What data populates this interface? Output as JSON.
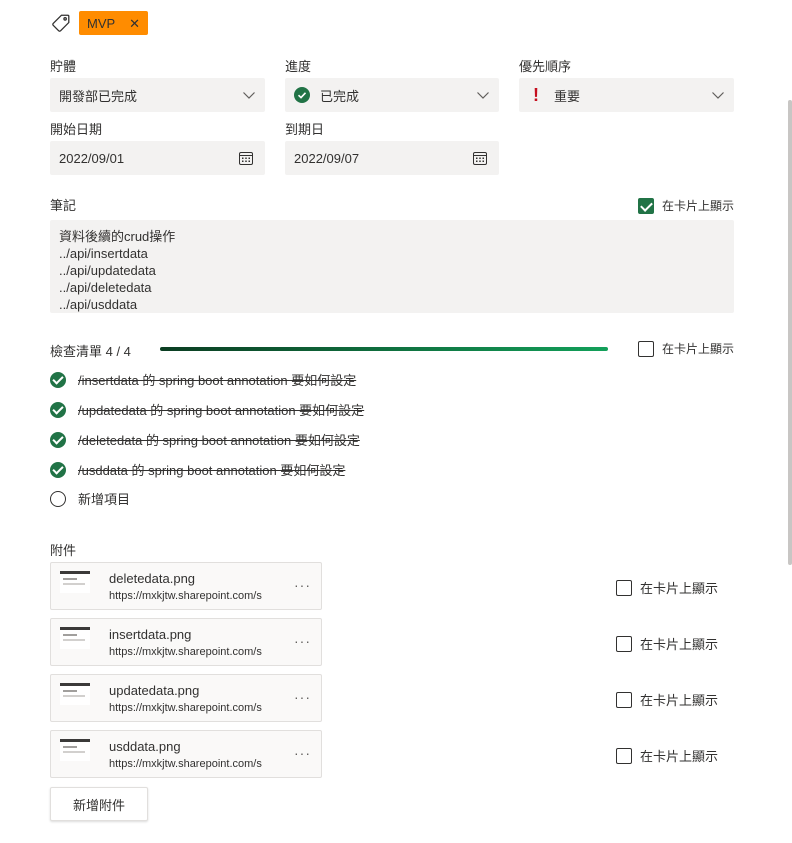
{
  "tag": {
    "label": "MVP",
    "color": "#ff8c00",
    "icon": "tag-icon",
    "close_icon": "close-icon",
    "close_glyph": "✕"
  },
  "bucket": {
    "label": "貯體",
    "value": "開發部已完成"
  },
  "progress": {
    "label": "進度",
    "value": "已完成",
    "icon": "completed-check-icon",
    "color": "#217346"
  },
  "priority": {
    "label": "優先順序",
    "value": "重要",
    "icon": "exclamation-icon",
    "glyph": "!",
    "color": "#c50f1f"
  },
  "start_date": {
    "label": "開始日期",
    "value": "2022/09/01",
    "icon": "calendar-icon"
  },
  "due_date": {
    "label": "到期日",
    "value": "2022/09/07",
    "icon": "calendar-icon"
  },
  "notes": {
    "label": "筆記",
    "show_on_card_label": "在卡片上顯示",
    "show_on_card_checked": true,
    "content": "資料後續的crud操作\n../api/insertdata\n../api/updatedata\n../api/deletedata\n../api/usddata"
  },
  "checklist": {
    "label": "檢查清單 4 / 4",
    "completed": 4,
    "total": 4,
    "show_on_card_label": "在卡片上顯示",
    "show_on_card_checked": false,
    "items": [
      {
        "text": "/insertdata 的 spring boot annotation 要如何設定",
        "done": true
      },
      {
        "text": "/updatedata 的 spring boot annotation 要如何設定",
        "done": true
      },
      {
        "text": "/deletedata 的 spring boot annotation 要如何設定",
        "done": true
      },
      {
        "text": "/usddata 的 spring boot annotation 要如何設定",
        "done": true
      }
    ],
    "add_item_label": "新增項目"
  },
  "attachments": {
    "label": "附件",
    "items": [
      {
        "name": "deletedata.png",
        "url": "https://mxkjtw.sharepoint.com/s",
        "show_on_card_label": "在卡片上顯示"
      },
      {
        "name": "insertdata.png",
        "url": "https://mxkjtw.sharepoint.com/s",
        "show_on_card_label": "在卡片上顯示"
      },
      {
        "name": "updatedata.png",
        "url": "https://mxkjtw.sharepoint.com/s",
        "show_on_card_label": "在卡片上顯示"
      },
      {
        "name": "usddata.png",
        "url": "https://mxkjtw.sharepoint.com/s",
        "show_on_card_label": "在卡片上顯示"
      }
    ],
    "more_glyph": "···",
    "add_button_label": "新增附件"
  }
}
